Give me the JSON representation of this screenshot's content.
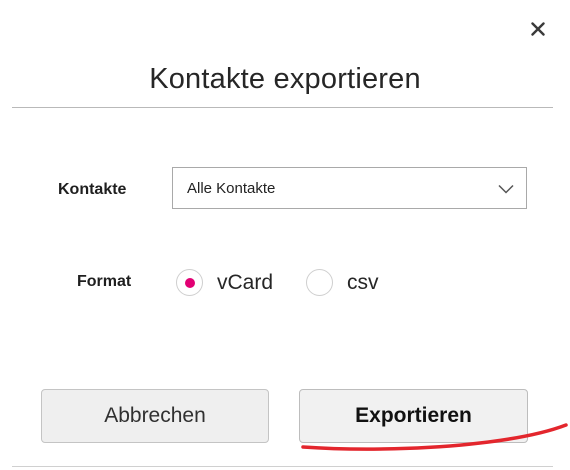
{
  "dialog": {
    "title": "Kontakte exportieren",
    "close_icon": "close-icon"
  },
  "form": {
    "contacts_label": "Kontakte",
    "contacts_select_value": "Alle Kontakte",
    "format_label": "Format",
    "format_options": [
      {
        "label": "vCard",
        "selected": true
      },
      {
        "label": "csv",
        "selected": false
      }
    ]
  },
  "buttons": {
    "cancel_label": "Abbrechen",
    "export_label": "Exportieren"
  },
  "colors": {
    "radio_selected": "#e20074",
    "annotation_stroke": "#e3262d"
  }
}
